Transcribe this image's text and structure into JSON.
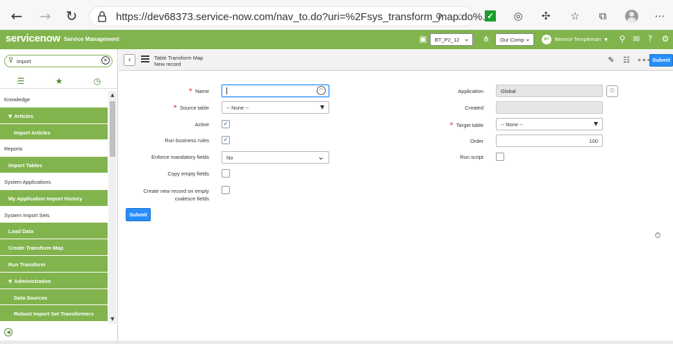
{
  "browser": {
    "url": "https://dev68373.service-now.com/nav_to.do?uri=%2Fsys_transform_map.do%..."
  },
  "header": {
    "logo_text": "servicenow",
    "app_title": "Service Management",
    "update_set": "BT_P2_12",
    "company": "Our Comp",
    "user_initials": "BT",
    "user_name": "Bernice Templeman"
  },
  "navigator": {
    "filter_value": "import",
    "items": [
      {
        "label": "Knowledge",
        "style": "section"
      },
      {
        "label": "Articles",
        "style": "group"
      },
      {
        "label": "Import Articles",
        "style": "child"
      },
      {
        "label": "Reports",
        "style": "section"
      },
      {
        "label": "Import Tables",
        "style": "module"
      },
      {
        "label": "System Applications",
        "style": "section"
      },
      {
        "label": "My Application Import History",
        "style": "module"
      },
      {
        "label": "System Import Sets",
        "style": "section"
      },
      {
        "label": "Load Data",
        "style": "module"
      },
      {
        "label": "Create Transform Map",
        "style": "module"
      },
      {
        "label": "Run Transform",
        "style": "module"
      },
      {
        "label": "Administration",
        "style": "group"
      },
      {
        "label": "Data Sources",
        "style": "child"
      },
      {
        "label": "Robust Import Set Transformers",
        "style": "child"
      }
    ]
  },
  "form": {
    "title": "Table Transform Map",
    "subtitle": "New record",
    "submit_label": "Submit",
    "fields": {
      "name_label": "Name",
      "name_value": "",
      "source_table_label": "Source table",
      "source_table_value": "-- None --",
      "active_label": "Active",
      "active_checked": true,
      "run_business_rules_label": "Run business rules",
      "run_business_rules_checked": true,
      "enforce_mandatory_label": "Enforce mandatory fields",
      "enforce_mandatory_value": "No",
      "copy_empty_label": "Copy empty fields",
      "copy_empty_checked": false,
      "create_new_label_line1": "Create new record on empty",
      "create_new_label_line2": "coalesce fields",
      "create_new_checked": false,
      "application_label": "Application",
      "application_value": "Global",
      "created_label": "Created",
      "created_value": "",
      "target_table_label": "Target table",
      "target_table_value": "-- None --",
      "order_label": "Order",
      "order_value": "100",
      "run_script_label": "Run script",
      "run_script_checked": false
    }
  },
  "colors": {
    "brand_green": "#81b44d",
    "submit_blue": "#278efc",
    "required_red": "#e0312e"
  }
}
